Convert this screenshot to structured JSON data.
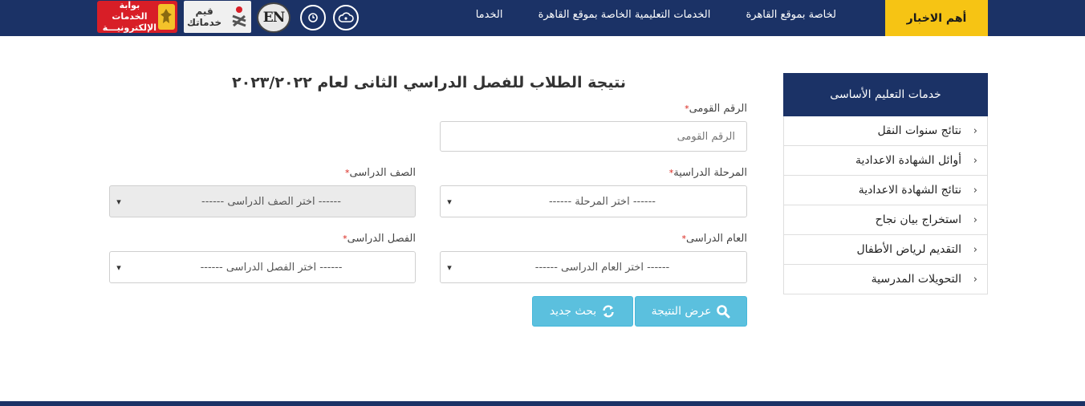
{
  "header": {
    "news_label": "أهم الاخبار",
    "ticker": [
      "لخاصة بموقع القاهرة",
      "الخدمات التعليمية الخاصة بموقع القاهرة",
      "الخدما"
    ],
    "en_logo": "EN",
    "qayem_logo": {
      "line1": "قيم",
      "line2": "خدماتك"
    },
    "gov_logo": {
      "line1": "بوابة الخدمات",
      "line2": "الإلكترونيـــة"
    },
    "icons": [
      "cloud-icon",
      "clock-icon"
    ],
    "colors": {
      "navy": "#1b3266",
      "yellow": "#f6c414",
      "red": "#d81e27",
      "info": "#5bc0de"
    }
  },
  "sidebar": {
    "title": "خدمات التعليم الأساسى",
    "items": [
      {
        "label": "نتائج سنوات النقل"
      },
      {
        "label": "أوائل الشهادة الاعدادية"
      },
      {
        "label": "نتائج الشهادة الاعدادية"
      },
      {
        "label": "استخراج بيان نجاح"
      },
      {
        "label": "التقديم لرياض الأطفال"
      },
      {
        "label": "التحويلات المدرسية"
      }
    ]
  },
  "form": {
    "title": "نتيجة الطلاب للفصل الدراسي الثانى لعام ٢٠٢٣/٢٠٢٢",
    "national_id": {
      "label": "الرقم القومى",
      "placeholder": "الرقم القومى",
      "value": ""
    },
    "stage": {
      "label": "المرحلة الدراسية",
      "selected": "------ اختر المرحلة ------"
    },
    "grade": {
      "label": "الصف الدراسى",
      "selected": "------ اختر الصف الدراسى ------"
    },
    "year": {
      "label": "العام الدراسى",
      "selected": "------ اختر العام الدراسى ------"
    },
    "term": {
      "label": "الفصل الدراسى",
      "selected": "------ اختر الفصل الدراسى ------"
    },
    "required_mark": "*",
    "show_result_label": "عرض النتيجة",
    "new_search_label": "بحث جديد"
  }
}
